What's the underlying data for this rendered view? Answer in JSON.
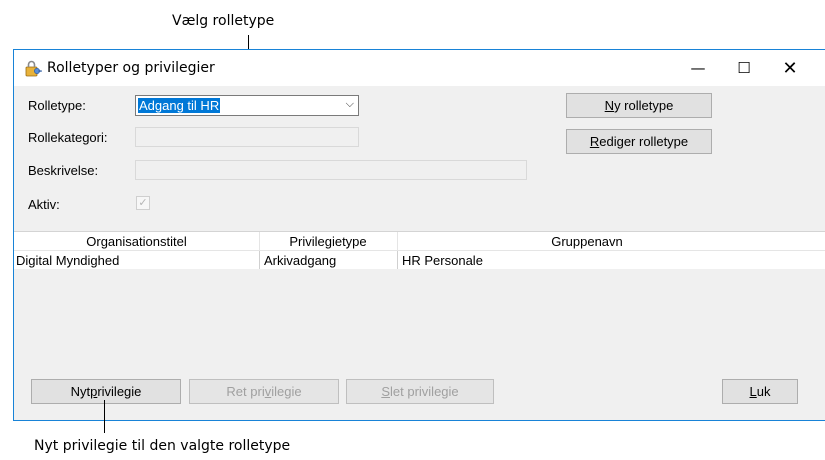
{
  "callouts": {
    "top": "Vælg rolletype",
    "bottom": "Nyt privilegie til den valgte rolletype"
  },
  "window": {
    "title": "Rolletyper og privilegier",
    "icon": "lock-key-icon",
    "controls": {
      "minimize": "—",
      "maximize": "☐",
      "close": "✕"
    }
  },
  "form": {
    "rolletype_label": "Rolletype:",
    "rolletype_value": "Adgang til HR",
    "rollekategori_label": "Rollekategori:",
    "rollekategori_value": "",
    "beskrivelse_label": "Beskrivelse:",
    "beskrivelse_value": "",
    "aktiv_label": "Aktiv:",
    "aktiv_checked": true
  },
  "buttons": {
    "ny_rolletype": {
      "accel": "N",
      "rest": "y rolletype"
    },
    "rediger_rolletype": {
      "accel": "R",
      "rest": "ediger rolletype"
    },
    "nyt_privilegie": {
      "pre": "Nyt ",
      "accel": "p",
      "rest": "rivilegie"
    },
    "ret_privilegie": {
      "pre": "Ret pri",
      "accel": "v",
      "rest": "ilegie"
    },
    "slet_privilegie": {
      "accel": "S",
      "rest": "let privilegie"
    },
    "luk": {
      "accel": "L",
      "rest": "uk"
    }
  },
  "grid": {
    "columns": [
      "Organisationstitel",
      "Privilegietype",
      "Gruppenavn"
    ],
    "rows": [
      [
        "Digital Myndighed",
        "Arkivadgang",
        "HR Personale"
      ]
    ]
  }
}
